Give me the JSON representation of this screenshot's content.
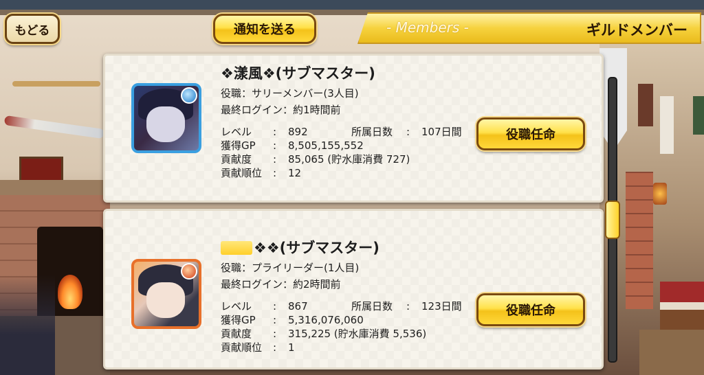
{
  "header": {
    "back_label": "もどる",
    "notify_label": "通知を送る",
    "banner_subtitle": "- Members -",
    "banner_title": "ギルドメンバー"
  },
  "members": [
    {
      "name": "❖漾風❖(サブマスター)",
      "role_label": "役職：",
      "role_value": "サリーメンバー(3人目)",
      "login_label": "最終ログイン：",
      "login_value": "約1時間前",
      "level_label": "レベル",
      "level_value": "892",
      "days_label": "所属日数",
      "days_value": "107日間",
      "gp_label": "獲得GP",
      "gp_value": "8,505,155,552",
      "contrib_label": "貢献度",
      "contrib_value": "85,065 (貯水庫消費 727)",
      "rank_label": "貢献順位",
      "rank_value": "12",
      "colon": ":",
      "appoint_label": "役職任命"
    },
    {
      "name": "❖❖(サブマスター)",
      "role_label": "役職：",
      "role_value": "プライリーダー(1人目)",
      "login_label": "最終ログイン：",
      "login_value": "約2時間前",
      "level_label": "レベル",
      "level_value": "867",
      "days_label": "所属日数",
      "days_value": "123日間",
      "gp_label": "獲得GP",
      "gp_value": "5,316,076,060",
      "contrib_label": "貢献度",
      "contrib_value": "315,225 (貯水庫消費 5,536)",
      "rank_label": "貢献順位",
      "rank_value": "1",
      "colon": ":",
      "appoint_label": "役職任命"
    }
  ],
  "scroll": {
    "position_fraction": 0.5
  }
}
